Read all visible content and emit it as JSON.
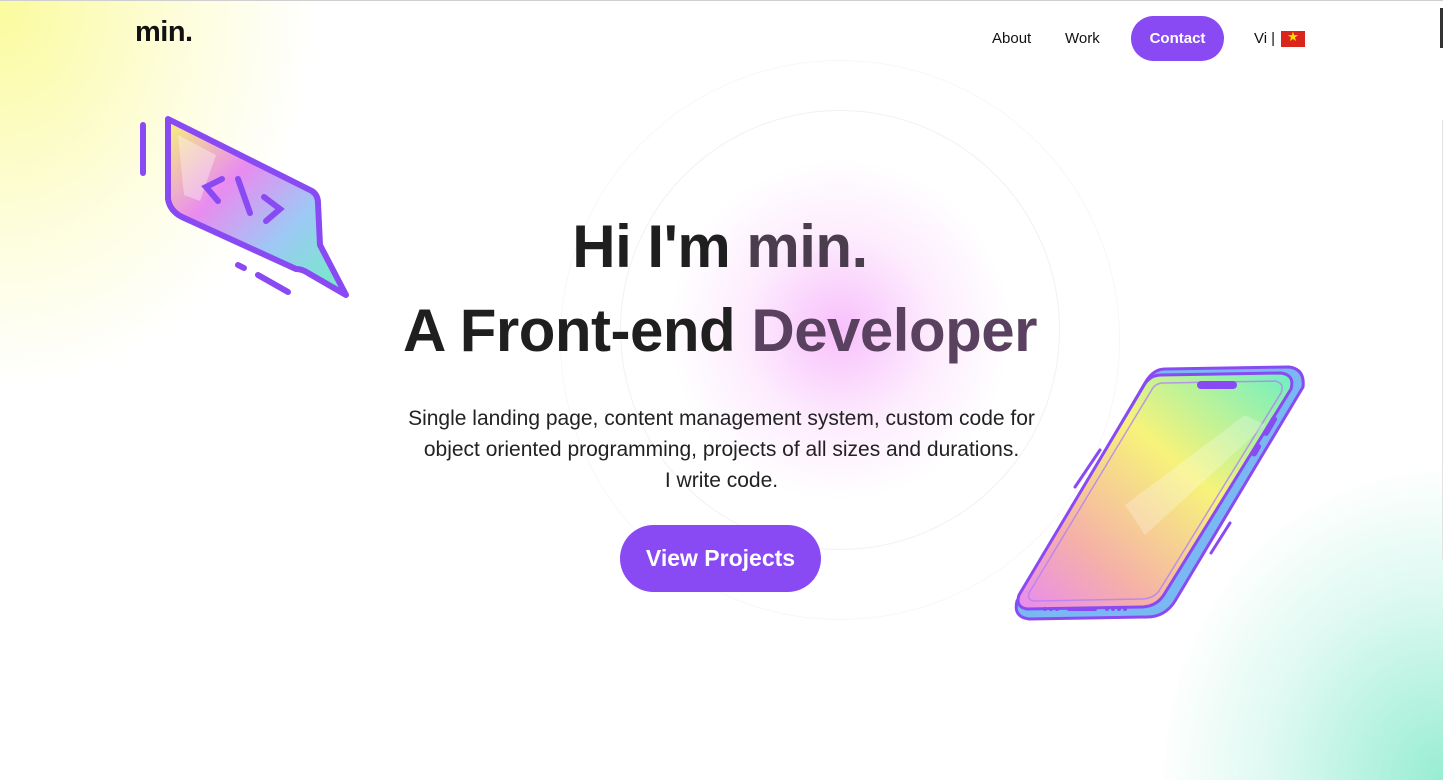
{
  "header": {
    "logo": "min.",
    "nav": {
      "about": "About",
      "work": "Work",
      "contact": "Contact"
    },
    "lang": {
      "label": "Vi",
      "separator": "|",
      "flag_icon": "vietnam-flag-icon"
    }
  },
  "hero": {
    "title_line1_a": "Hi I'm ",
    "title_line1_b": "min.",
    "title_line2_a": "A Front-end ",
    "title_line2_b": "Developer",
    "desc_line1": "Single landing page, content management system, custom code for",
    "desc_line2": "object oriented programming, projects of all sizes and durations.",
    "desc_line3": "I write code.",
    "cta_label": "View Projects"
  },
  "illustrations": {
    "left": "code-chat-bubble-icon",
    "right": "smartphone-icon"
  },
  "colors": {
    "accent": "#8a4af3",
    "text": "#1f1f1f"
  }
}
